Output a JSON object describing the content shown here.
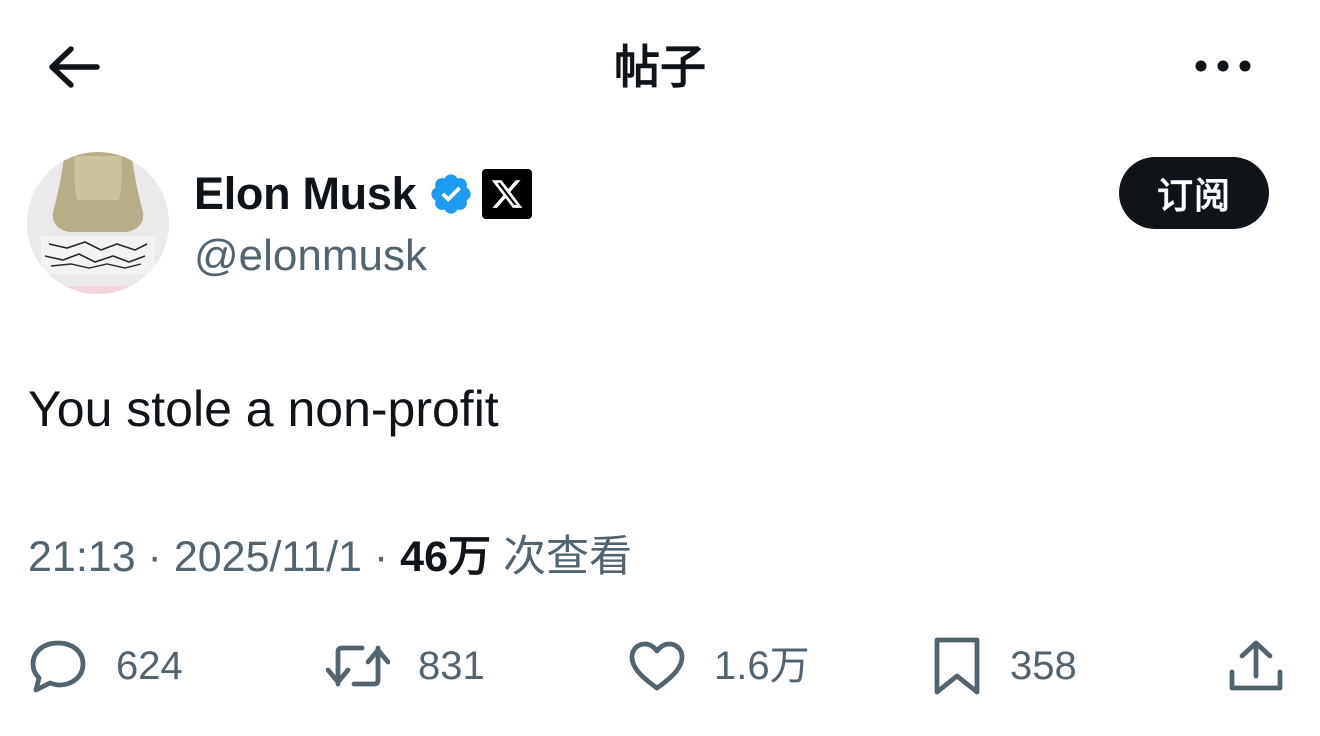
{
  "header": {
    "title": "帖子",
    "back_icon": "arrow-left-icon",
    "more_icon": "more-horizontal-icon"
  },
  "author": {
    "display_name": "Elon Musk",
    "handle": "@elonmusk",
    "verified_icon": "verified-badge-icon",
    "affiliation_icon": "x-logo-icon",
    "verified_color": "#1d9bf0"
  },
  "subscribe_label": "订阅",
  "tweet": {
    "text": "You stole a non-profit",
    "time": "21:13",
    "sep1": " · ",
    "date": "2025/11/1",
    "sep2": " · ",
    "views_count": "46万",
    "views_label": " 次查看"
  },
  "actions": {
    "reply": {
      "icon": "reply-icon",
      "count": "624"
    },
    "retweet": {
      "icon": "retweet-icon",
      "count": "831"
    },
    "like": {
      "icon": "heart-icon",
      "count": "1.6万"
    },
    "bookmark": {
      "icon": "bookmark-icon",
      "count": "358"
    },
    "share": {
      "icon": "share-icon"
    }
  },
  "colors": {
    "text_primary": "#0f1419",
    "text_secondary": "#536471",
    "button_dark": "#0f1419"
  }
}
